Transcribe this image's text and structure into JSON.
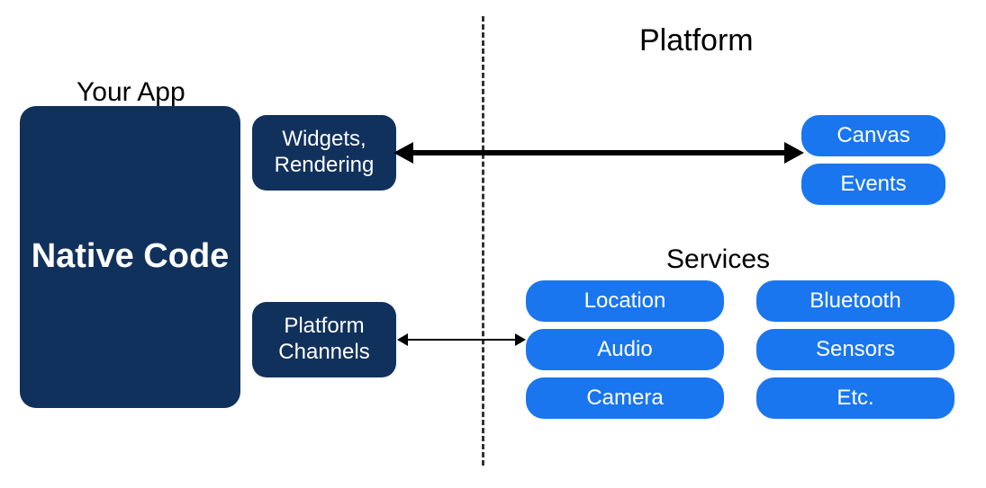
{
  "headings": {
    "platform": "Platform",
    "your_app": "Your App",
    "services": "Services"
  },
  "app_side": {
    "native_code": "Native Code",
    "widgets_rendering": "Widgets, Rendering",
    "platform_channels": "Platform Channels"
  },
  "platform_side": {
    "canvas": "Canvas",
    "events": "Events",
    "services": {
      "location": "Location",
      "bluetooth": "Bluetooth",
      "audio": "Audio",
      "sensors": "Sensors",
      "camera": "Camera",
      "etc": "Etc."
    }
  },
  "colors": {
    "dark_blue": "#11315d",
    "bright_blue": "#1976ee"
  }
}
